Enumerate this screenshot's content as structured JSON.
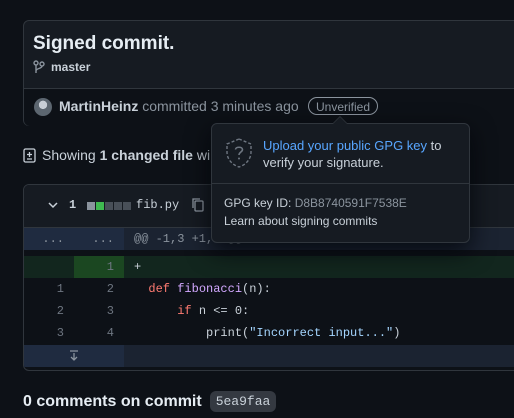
{
  "commit": {
    "title": "Signed commit.",
    "branch": "master",
    "author": "MartinHeinz",
    "meta_suffix": "committed 3 minutes ago",
    "badge": "Unverified"
  },
  "summary": {
    "prefix": "Showing",
    "changed": "1 changed file",
    "suffix": "wi"
  },
  "diff": {
    "count": "1",
    "filename": "fib.py",
    "hunk_left": "...",
    "hunk_right": "...",
    "hunk_text": "@@ -1,3 +1,4 @@",
    "lines": [
      {
        "old": "",
        "new": "1",
        "text": "+"
      },
      {
        "old": "1",
        "new": "2",
        "pre": "  ",
        "kw": "def",
        "fn": "fibonacci",
        "rest": "(n):"
      },
      {
        "old": "2",
        "new": "3",
        "pre": "      ",
        "kw": "if",
        "rest": " n <= 0:"
      },
      {
        "old": "3",
        "new": "4",
        "pre": "          ",
        "call": "print(",
        "str": "\"Incorrect input...\"",
        "end": ")"
      }
    ],
    "diffstat_colors": [
      "#8b949e",
      "#3fb950",
      "#484f58",
      "#484f58",
      "#484f58"
    ]
  },
  "comments": {
    "label": "0 comments on commit",
    "sha": "5ea9faa"
  },
  "popover": {
    "msg_link": "Upload your public GPG key",
    "msg_rest": " to verify your signature.",
    "key_label": "GPG key ID:",
    "key_id": "D8B8740591F7538E",
    "learn": "Learn about signing commits"
  },
  "colors": {
    "background": "#0d1117",
    "link": "#58a6ff",
    "added": "#12261e"
  }
}
